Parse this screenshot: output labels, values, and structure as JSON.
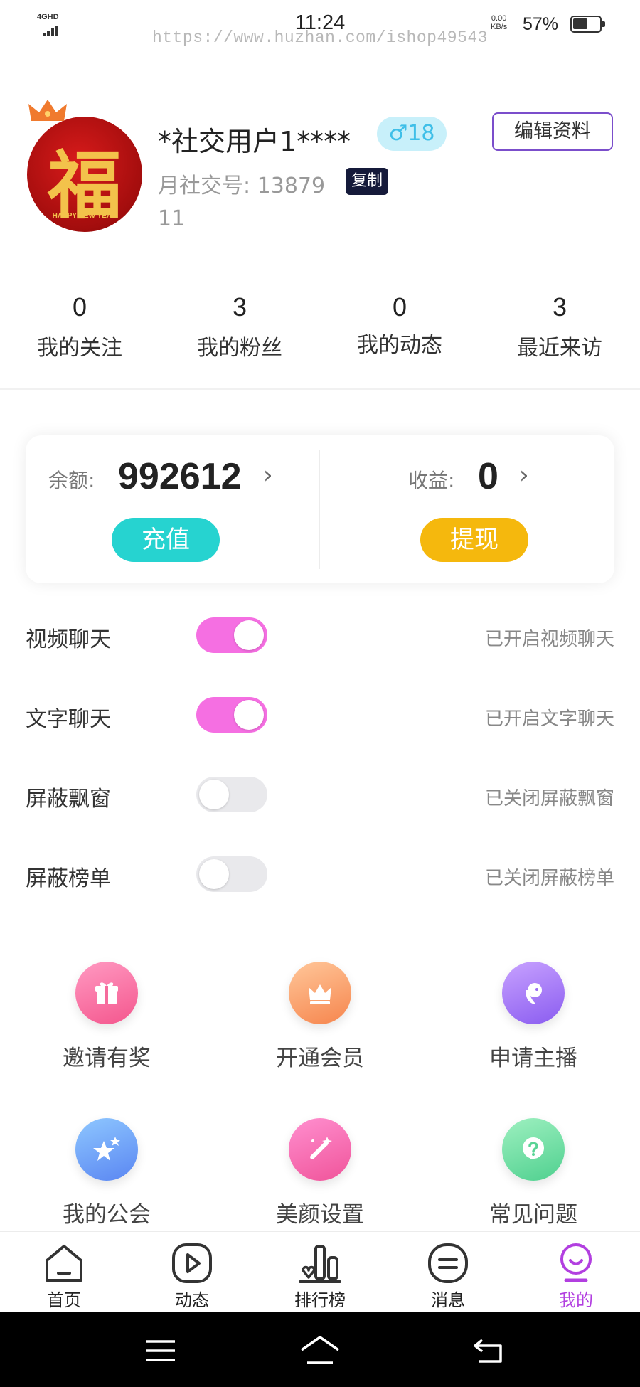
{
  "status_bar": {
    "network": "4GHD",
    "time": "11:24",
    "watermark": "https://www.huzhan.com/ishop49543",
    "speed_value": "0.00",
    "speed_unit": "KB/s",
    "battery_percent": "57%",
    "battery_level": 0.57
  },
  "profile": {
    "avatar_text": "福",
    "avatar_caption": "HAPPY NEW YEAR",
    "username": "*社交用户1****",
    "gender_age": "♂18",
    "edit_label": "编辑资料",
    "uid": "月社交号: 13879",
    "copy_label": "复制",
    "signature": "11"
  },
  "stats": [
    {
      "count": "0",
      "label": "我的关注"
    },
    {
      "count": "3",
      "label": "我的粉丝"
    },
    {
      "count": "0",
      "label": "我的动态"
    },
    {
      "count": "3",
      "label": "最近来访"
    }
  ],
  "wallet": {
    "balance_label": "余额:",
    "balance_value": "992612",
    "recharge_label": "充值",
    "income_label": "收益:",
    "income_value": "0",
    "withdraw_label": "提现",
    "arrow": "›"
  },
  "toggles": [
    {
      "label": "视频聊天",
      "on": true,
      "status": "已开启视频聊天"
    },
    {
      "label": "文字聊天",
      "on": true,
      "status": "已开启文字聊天"
    },
    {
      "label": "屏蔽飘窗",
      "on": false,
      "status": "已关闭屏蔽飘窗"
    },
    {
      "label": "屏蔽榜单",
      "on": false,
      "status": "已关闭屏蔽榜单"
    }
  ],
  "grid": [
    {
      "label": "邀请有奖",
      "icon": "gift-icon"
    },
    {
      "label": "开通会员",
      "icon": "crown-icon"
    },
    {
      "label": "申请主播",
      "icon": "host-icon"
    },
    {
      "label": "我的公会",
      "icon": "star-icon"
    },
    {
      "label": "美颜设置",
      "icon": "magic-wand-icon"
    },
    {
      "label": "常见问题",
      "icon": "question-icon"
    }
  ],
  "tabs": [
    {
      "label": "首页",
      "icon": "home-icon"
    },
    {
      "label": "动态",
      "icon": "play-icon"
    },
    {
      "label": "排行榜",
      "icon": "ranking-icon"
    },
    {
      "label": "消息",
      "icon": "message-icon"
    },
    {
      "label": "我的",
      "icon": "profile-icon",
      "active": true
    }
  ],
  "colors": {
    "accent_purple": "#b23fe0",
    "toggle_on": "#f56fe2",
    "recharge": "#26d3d0",
    "withdraw": "#f5b80d",
    "gender_badge": "#c8f0fa"
  }
}
